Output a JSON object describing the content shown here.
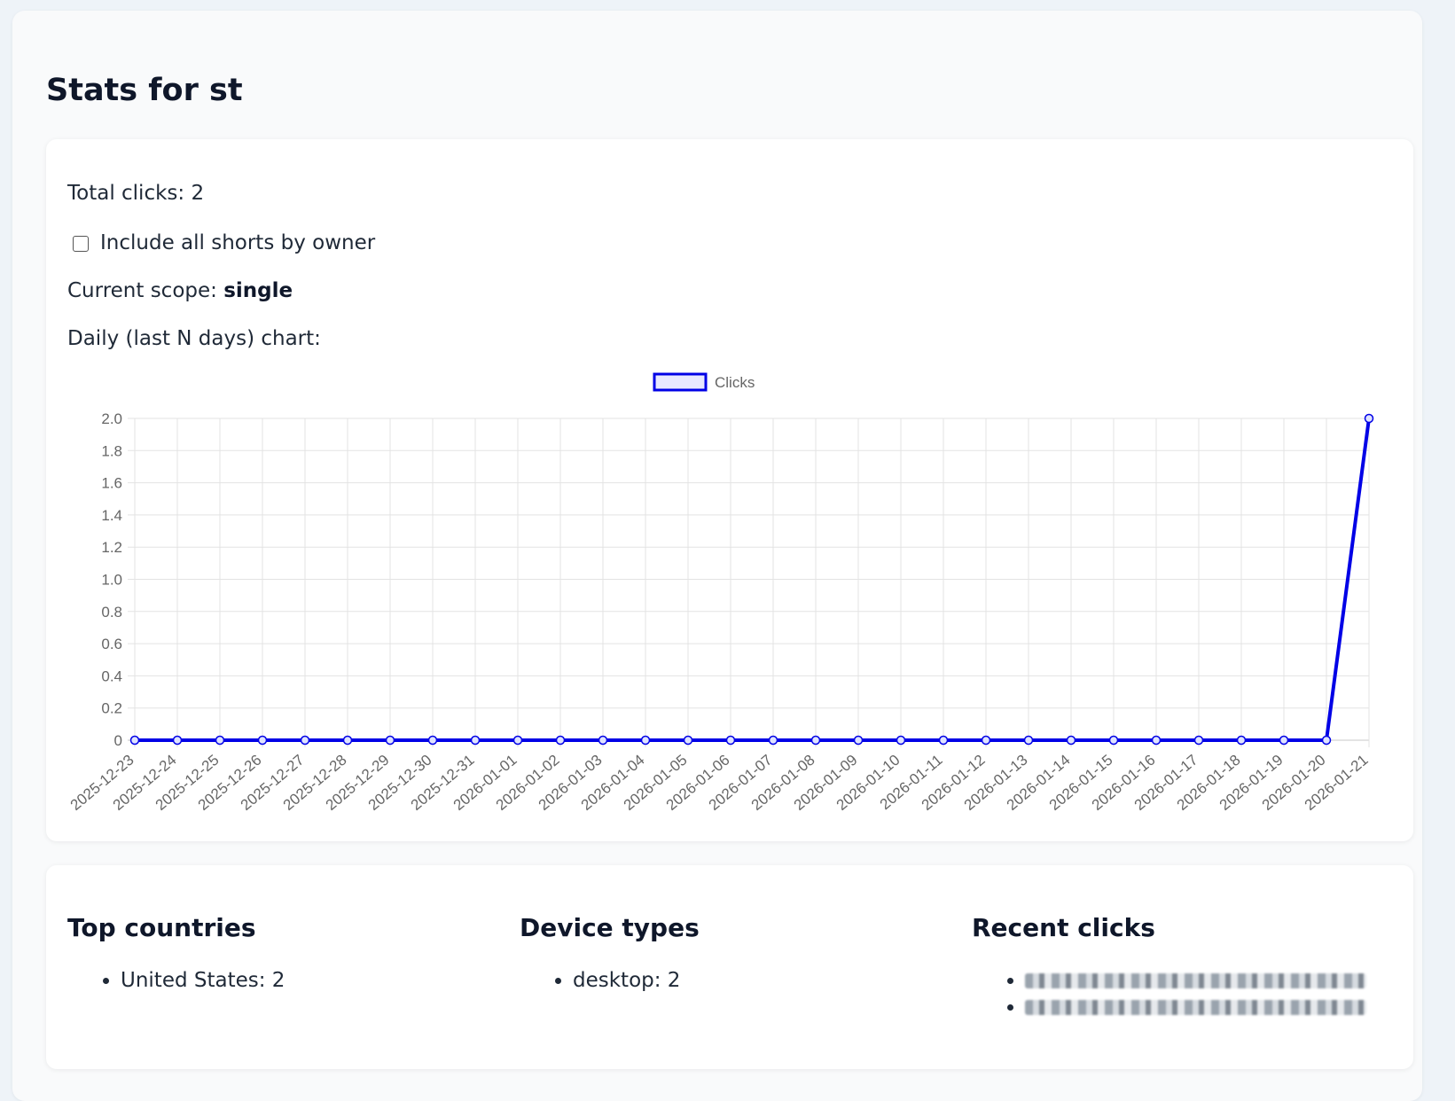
{
  "page": {
    "title": "Stats for st"
  },
  "stats": {
    "total_clicks": "Total clicks: 2",
    "include_all_label": "Include all shorts by owner",
    "include_all_checked": false,
    "scope_prefix": "Current scope: ",
    "scope_value": "single",
    "chart_caption": "Daily (last N days) chart:"
  },
  "chart_data": {
    "type": "line",
    "legend": [
      "Clicks"
    ],
    "legend_position": "top-center",
    "grid": true,
    "line_color": "#0000e6",
    "x": [
      "2025-12-23",
      "2025-12-24",
      "2025-12-25",
      "2025-12-26",
      "2025-12-27",
      "2025-12-28",
      "2025-12-29",
      "2025-12-30",
      "2025-12-31",
      "2026-01-01",
      "2026-01-02",
      "2026-01-03",
      "2026-01-04",
      "2026-01-05",
      "2026-01-06",
      "2026-01-07",
      "2026-01-08",
      "2026-01-09",
      "2026-01-10",
      "2026-01-11",
      "2026-01-12",
      "2026-01-13",
      "2026-01-14",
      "2026-01-15",
      "2026-01-16",
      "2026-01-17",
      "2026-01-18",
      "2026-01-19",
      "2026-01-20",
      "2026-01-21"
    ],
    "series": [
      {
        "name": "Clicks",
        "values": [
          0,
          0,
          0,
          0,
          0,
          0,
          0,
          0,
          0,
          0,
          0,
          0,
          0,
          0,
          0,
          0,
          0,
          0,
          0,
          0,
          0,
          0,
          0,
          0,
          0,
          0,
          0,
          0,
          0,
          2
        ]
      }
    ],
    "y_ticks": [
      "0",
      "0.2",
      "0.4",
      "0.6",
      "0.8",
      "1.0",
      "1.2",
      "1.4",
      "1.6",
      "1.8",
      "2.0"
    ],
    "ylim": [
      0,
      2
    ]
  },
  "lists": {
    "countries": {
      "heading": "Top countries",
      "items": [
        "United States: 2"
      ]
    },
    "devices": {
      "heading": "Device types",
      "items": [
        "desktop: 2"
      ]
    },
    "recent": {
      "heading": "Recent clicks"
    }
  }
}
